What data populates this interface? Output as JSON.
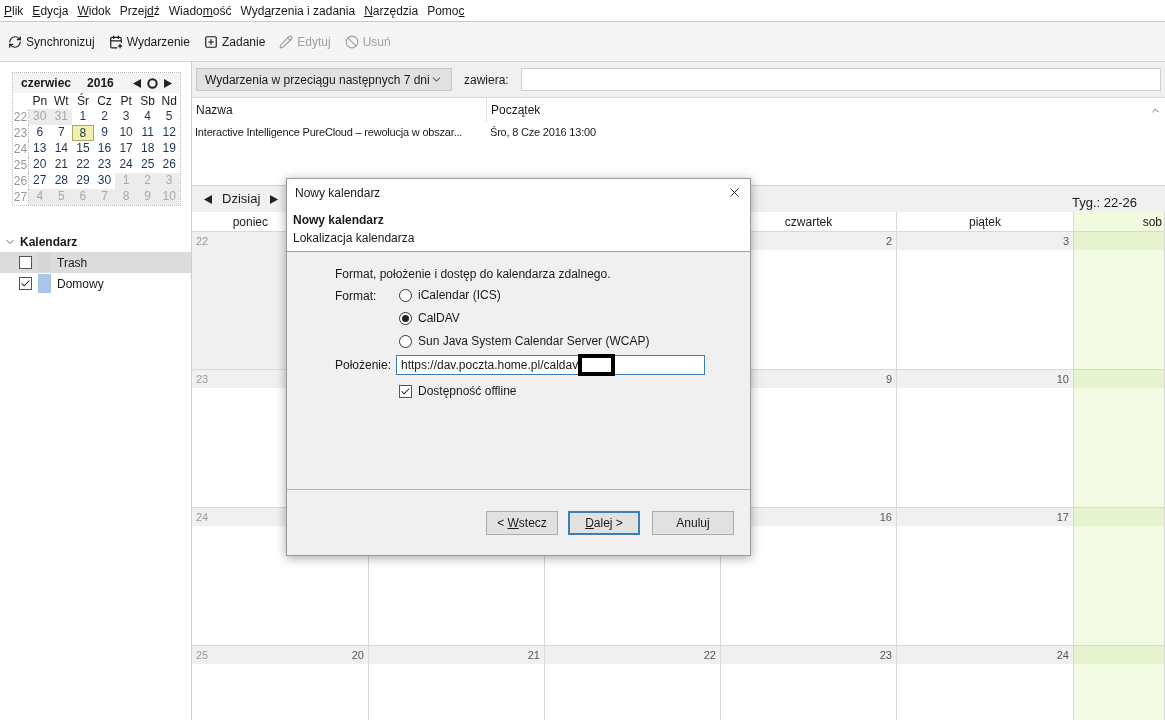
{
  "menu": [
    {
      "key": "P",
      "post": "lik"
    },
    {
      "key": "E",
      "post": "dycja"
    },
    {
      "key": "W",
      "post": "idok"
    },
    {
      "pre": "Przej",
      "key": "d",
      "post": "ź"
    },
    {
      "pre": "Wiado",
      "key": "m",
      "post": "ość"
    },
    {
      "pre": "Wyd",
      "key": "a",
      "post": "rzenia i zadania"
    },
    {
      "key": "N",
      "post": "arzędzia"
    },
    {
      "pre": "Pomo",
      "key": "c"
    }
  ],
  "toolbar": [
    {
      "kind": "sync",
      "label": "Synchronizuj",
      "disabled": false
    },
    {
      "kind": "event",
      "label": "Wydarzenie",
      "disabled": false
    },
    {
      "kind": "task",
      "label": "Zadanie",
      "disabled": false
    },
    {
      "kind": "edit",
      "label": "Edytuj",
      "disabled": true
    },
    {
      "kind": "delete",
      "label": "Usuń",
      "disabled": true
    }
  ],
  "minicalendar": {
    "month": "czerwiec",
    "year": "2016",
    "weekdays": [
      "Pn",
      "Wt",
      "Śr",
      "Cz",
      "Pt",
      "Sb",
      "Nd"
    ],
    "weeks": [
      {
        "number": "22",
        "days": [
          {
            "d": "30",
            "other": true,
            "selected": false
          },
          {
            "d": "31",
            "other": true,
            "selected": false
          },
          {
            "d": "1",
            "other": false,
            "selected": false
          },
          {
            "d": "2",
            "other": false,
            "selected": false
          },
          {
            "d": "3",
            "other": false,
            "selected": false
          },
          {
            "d": "4",
            "other": false,
            "selected": false
          },
          {
            "d": "5",
            "other": false,
            "selected": false
          }
        ]
      },
      {
        "number": "23",
        "days": [
          {
            "d": "6",
            "other": false,
            "selected": false
          },
          {
            "d": "7",
            "other": false,
            "selected": false
          },
          {
            "d": "8",
            "other": false,
            "selected": true
          },
          {
            "d": "9",
            "other": false,
            "selected": false
          },
          {
            "d": "10",
            "other": false,
            "selected": false
          },
          {
            "d": "11",
            "other": false,
            "selected": false
          },
          {
            "d": "12",
            "other": false,
            "selected": false
          }
        ]
      },
      {
        "number": "24",
        "days": [
          {
            "d": "13",
            "other": false,
            "selected": false
          },
          {
            "d": "14",
            "other": false,
            "selected": false
          },
          {
            "d": "15",
            "other": false,
            "selected": false
          },
          {
            "d": "16",
            "other": false,
            "selected": false
          },
          {
            "d": "17",
            "other": false,
            "selected": false
          },
          {
            "d": "18",
            "other": false,
            "selected": false
          },
          {
            "d": "19",
            "other": false,
            "selected": false
          }
        ]
      },
      {
        "number": "25",
        "days": [
          {
            "d": "20",
            "other": false,
            "selected": false
          },
          {
            "d": "21",
            "other": false,
            "selected": false
          },
          {
            "d": "22",
            "other": false,
            "selected": false
          },
          {
            "d": "23",
            "other": false,
            "selected": false
          },
          {
            "d": "24",
            "other": false,
            "selected": false
          },
          {
            "d": "25",
            "other": false,
            "selected": false
          },
          {
            "d": "26",
            "other": false,
            "selected": false
          }
        ]
      },
      {
        "number": "26",
        "days": [
          {
            "d": "27",
            "other": false,
            "selected": false
          },
          {
            "d": "28",
            "other": false,
            "selected": false
          },
          {
            "d": "29",
            "other": false,
            "selected": false
          },
          {
            "d": "30",
            "other": false,
            "selected": false
          },
          {
            "d": "1",
            "other": true,
            "selected": false
          },
          {
            "d": "2",
            "other": true,
            "selected": false
          },
          {
            "d": "3",
            "other": true,
            "selected": false
          }
        ]
      },
      {
        "number": "27",
        "days": [
          {
            "d": "4",
            "other": true,
            "selected": false
          },
          {
            "d": "5",
            "other": true,
            "selected": false
          },
          {
            "d": "6",
            "other": true,
            "selected": false
          },
          {
            "d": "7",
            "other": true,
            "selected": false
          },
          {
            "d": "8",
            "other": true,
            "selected": false
          },
          {
            "d": "9",
            "other": true,
            "selected": false
          },
          {
            "d": "10",
            "other": true,
            "selected": false
          }
        ]
      }
    ]
  },
  "calendars": {
    "title": "Kalendarz",
    "expanded": true,
    "items": [
      {
        "name": "Trash",
        "checked": false,
        "color": "#d6d6d6",
        "selected": true
      },
      {
        "name": "Domowy",
        "checked": true,
        "color": "#a9c5e8",
        "selected": false
      }
    ]
  },
  "filter": {
    "range": "Wydarzenia w przeciągu następnych 7 dni",
    "contains_label": "zawiera:"
  },
  "events": {
    "columns": [
      "Nazwa",
      "Początek"
    ],
    "rows": [
      [
        "Interactive Intelligence PureCloud – rewolucja w obszar...",
        "Śro, 8 Cze 2016 13:00"
      ]
    ]
  },
  "nav": {
    "today": "Dzisiaj",
    "week_range": "Tyg.: 22-26"
  },
  "week_view": {
    "headers": {
      "mon": {
        "label": "poniec",
        "weekend": false
      },
      "thu": {
        "label": "czwartek",
        "weekend": false
      },
      "fri": {
        "label": "piątek",
        "weekend": false
      },
      "sat": {
        "label": "sob",
        "weekend": true
      }
    },
    "rows": [
      {
        "week": "22",
        "mon": {
          "other": true
        },
        "thu": {
          "d": "2",
          "other": false
        },
        "fri": {
          "d": "3",
          "other": false
        },
        "sat": {
          "other": false
        }
      },
      {
        "week": "23",
        "mon": {
          "other": false
        },
        "thu": {
          "d": "9",
          "other": false
        },
        "fri": {
          "d": "10",
          "other": false
        },
        "sat": {
          "other": false
        }
      },
      {
        "week": "24",
        "mon": {
          "other": false
        },
        "tue": {
          "other": false
        },
        "wed": {
          "other": false
        },
        "thu": {
          "d": "16",
          "other": false
        },
        "fri": {
          "d": "17",
          "other": false
        },
        "sat": {
          "other": false
        }
      },
      {
        "week": "25",
        "mon": {
          "d": "20",
          "other": false
        },
        "tue": {
          "d": "21",
          "other": false
        },
        "wed": {
          "d": "22",
          "other": false
        },
        "thu": {
          "d": "23",
          "other": false
        },
        "fri": {
          "d": "24",
          "other": false
        },
        "sat": {
          "other": false
        }
      }
    ]
  },
  "dialog": {
    "title": "Nowy kalendarz",
    "heading": "Nowy kalendarz",
    "subheading": "Lokalizacja kalendarza",
    "intro": "Format, położenie i dostęp do kalendarza zdalnego.",
    "format_label": "Format:",
    "formats": [
      {
        "label": "iCalendar (ICS)",
        "selected": false
      },
      {
        "label": "CalDAV",
        "selected": true
      },
      {
        "label": "Sun Java System Calendar Server (WCAP)",
        "selected": false
      }
    ],
    "location_label": "Położenie:",
    "location_value": "https://dav.poczta.home.pl/caldav",
    "redacted": true,
    "offline": {
      "label": "Dostępność offline",
      "checked": true
    },
    "buttons": [
      {
        "pre": "< ",
        "key": "W",
        "post": "stecz",
        "default": false
      },
      {
        "key": "D",
        "post": "alej >",
        "default": true
      },
      {
        "pre": "Anuluj",
        "default": false
      }
    ]
  }
}
